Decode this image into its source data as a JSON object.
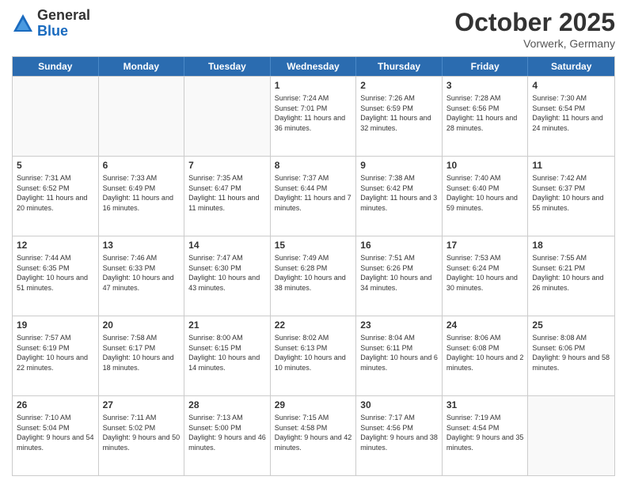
{
  "logo": {
    "general": "General",
    "blue": "Blue"
  },
  "header": {
    "month": "October 2025",
    "location": "Vorwerk, Germany"
  },
  "weekdays": [
    "Sunday",
    "Monday",
    "Tuesday",
    "Wednesday",
    "Thursday",
    "Friday",
    "Saturday"
  ],
  "weeks": [
    [
      {
        "day": "",
        "sunrise": "",
        "sunset": "",
        "daylight": ""
      },
      {
        "day": "",
        "sunrise": "",
        "sunset": "",
        "daylight": ""
      },
      {
        "day": "",
        "sunrise": "",
        "sunset": "",
        "daylight": ""
      },
      {
        "day": "1",
        "sunrise": "Sunrise: 7:24 AM",
        "sunset": "Sunset: 7:01 PM",
        "daylight": "Daylight: 11 hours and 36 minutes."
      },
      {
        "day": "2",
        "sunrise": "Sunrise: 7:26 AM",
        "sunset": "Sunset: 6:59 PM",
        "daylight": "Daylight: 11 hours and 32 minutes."
      },
      {
        "day": "3",
        "sunrise": "Sunrise: 7:28 AM",
        "sunset": "Sunset: 6:56 PM",
        "daylight": "Daylight: 11 hours and 28 minutes."
      },
      {
        "day": "4",
        "sunrise": "Sunrise: 7:30 AM",
        "sunset": "Sunset: 6:54 PM",
        "daylight": "Daylight: 11 hours and 24 minutes."
      }
    ],
    [
      {
        "day": "5",
        "sunrise": "Sunrise: 7:31 AM",
        "sunset": "Sunset: 6:52 PM",
        "daylight": "Daylight: 11 hours and 20 minutes."
      },
      {
        "day": "6",
        "sunrise": "Sunrise: 7:33 AM",
        "sunset": "Sunset: 6:49 PM",
        "daylight": "Daylight: 11 hours and 16 minutes."
      },
      {
        "day": "7",
        "sunrise": "Sunrise: 7:35 AM",
        "sunset": "Sunset: 6:47 PM",
        "daylight": "Daylight: 11 hours and 11 minutes."
      },
      {
        "day": "8",
        "sunrise": "Sunrise: 7:37 AM",
        "sunset": "Sunset: 6:44 PM",
        "daylight": "Daylight: 11 hours and 7 minutes."
      },
      {
        "day": "9",
        "sunrise": "Sunrise: 7:38 AM",
        "sunset": "Sunset: 6:42 PM",
        "daylight": "Daylight: 11 hours and 3 minutes."
      },
      {
        "day": "10",
        "sunrise": "Sunrise: 7:40 AM",
        "sunset": "Sunset: 6:40 PM",
        "daylight": "Daylight: 10 hours and 59 minutes."
      },
      {
        "day": "11",
        "sunrise": "Sunrise: 7:42 AM",
        "sunset": "Sunset: 6:37 PM",
        "daylight": "Daylight: 10 hours and 55 minutes."
      }
    ],
    [
      {
        "day": "12",
        "sunrise": "Sunrise: 7:44 AM",
        "sunset": "Sunset: 6:35 PM",
        "daylight": "Daylight: 10 hours and 51 minutes."
      },
      {
        "day": "13",
        "sunrise": "Sunrise: 7:46 AM",
        "sunset": "Sunset: 6:33 PM",
        "daylight": "Daylight: 10 hours and 47 minutes."
      },
      {
        "day": "14",
        "sunrise": "Sunrise: 7:47 AM",
        "sunset": "Sunset: 6:30 PM",
        "daylight": "Daylight: 10 hours and 43 minutes."
      },
      {
        "day": "15",
        "sunrise": "Sunrise: 7:49 AM",
        "sunset": "Sunset: 6:28 PM",
        "daylight": "Daylight: 10 hours and 38 minutes."
      },
      {
        "day": "16",
        "sunrise": "Sunrise: 7:51 AM",
        "sunset": "Sunset: 6:26 PM",
        "daylight": "Daylight: 10 hours and 34 minutes."
      },
      {
        "day": "17",
        "sunrise": "Sunrise: 7:53 AM",
        "sunset": "Sunset: 6:24 PM",
        "daylight": "Daylight: 10 hours and 30 minutes."
      },
      {
        "day": "18",
        "sunrise": "Sunrise: 7:55 AM",
        "sunset": "Sunset: 6:21 PM",
        "daylight": "Daylight: 10 hours and 26 minutes."
      }
    ],
    [
      {
        "day": "19",
        "sunrise": "Sunrise: 7:57 AM",
        "sunset": "Sunset: 6:19 PM",
        "daylight": "Daylight: 10 hours and 22 minutes."
      },
      {
        "day": "20",
        "sunrise": "Sunrise: 7:58 AM",
        "sunset": "Sunset: 6:17 PM",
        "daylight": "Daylight: 10 hours and 18 minutes."
      },
      {
        "day": "21",
        "sunrise": "Sunrise: 8:00 AM",
        "sunset": "Sunset: 6:15 PM",
        "daylight": "Daylight: 10 hours and 14 minutes."
      },
      {
        "day": "22",
        "sunrise": "Sunrise: 8:02 AM",
        "sunset": "Sunset: 6:13 PM",
        "daylight": "Daylight: 10 hours and 10 minutes."
      },
      {
        "day": "23",
        "sunrise": "Sunrise: 8:04 AM",
        "sunset": "Sunset: 6:11 PM",
        "daylight": "Daylight: 10 hours and 6 minutes."
      },
      {
        "day": "24",
        "sunrise": "Sunrise: 8:06 AM",
        "sunset": "Sunset: 6:08 PM",
        "daylight": "Daylight: 10 hours and 2 minutes."
      },
      {
        "day": "25",
        "sunrise": "Sunrise: 8:08 AM",
        "sunset": "Sunset: 6:06 PM",
        "daylight": "Daylight: 9 hours and 58 minutes."
      }
    ],
    [
      {
        "day": "26",
        "sunrise": "Sunrise: 7:10 AM",
        "sunset": "Sunset: 5:04 PM",
        "daylight": "Daylight: 9 hours and 54 minutes."
      },
      {
        "day": "27",
        "sunrise": "Sunrise: 7:11 AM",
        "sunset": "Sunset: 5:02 PM",
        "daylight": "Daylight: 9 hours and 50 minutes."
      },
      {
        "day": "28",
        "sunrise": "Sunrise: 7:13 AM",
        "sunset": "Sunset: 5:00 PM",
        "daylight": "Daylight: 9 hours and 46 minutes."
      },
      {
        "day": "29",
        "sunrise": "Sunrise: 7:15 AM",
        "sunset": "Sunset: 4:58 PM",
        "daylight": "Daylight: 9 hours and 42 minutes."
      },
      {
        "day": "30",
        "sunrise": "Sunrise: 7:17 AM",
        "sunset": "Sunset: 4:56 PM",
        "daylight": "Daylight: 9 hours and 38 minutes."
      },
      {
        "day": "31",
        "sunrise": "Sunrise: 7:19 AM",
        "sunset": "Sunset: 4:54 PM",
        "daylight": "Daylight: 9 hours and 35 minutes."
      },
      {
        "day": "",
        "sunrise": "",
        "sunset": "",
        "daylight": ""
      }
    ]
  ]
}
